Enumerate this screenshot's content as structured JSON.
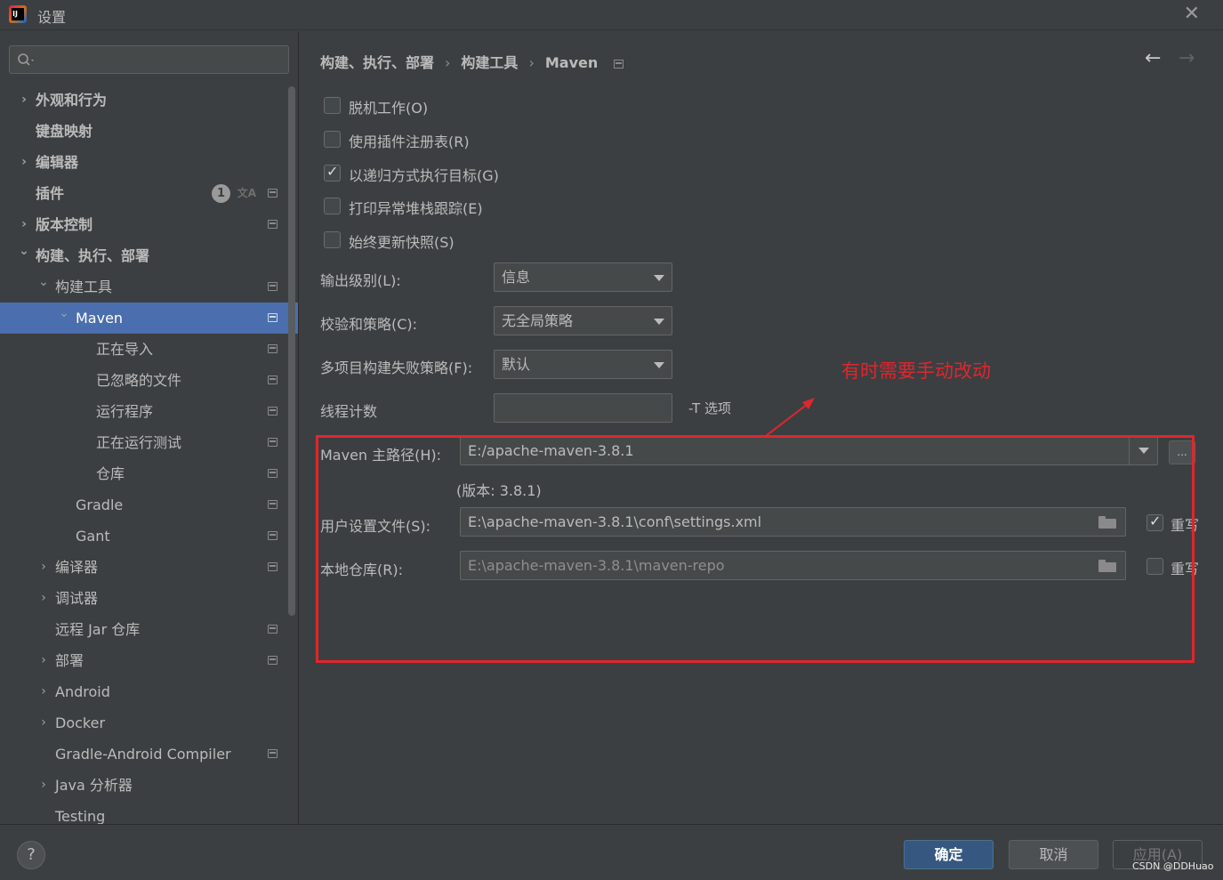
{
  "window": {
    "title": "设置"
  },
  "sidebar": {
    "search": {
      "placeholder": ""
    },
    "items": [
      {
        "label": "外观和行为",
        "arrow": "›",
        "indent": 0,
        "bold": true,
        "proj": false
      },
      {
        "label": "键盘映射",
        "arrow": "",
        "indent": 0,
        "bold": true,
        "proj": false
      },
      {
        "label": "编辑器",
        "arrow": "›",
        "indent": 0,
        "bold": true,
        "proj": false
      },
      {
        "label": "插件",
        "arrow": "",
        "indent": 0,
        "bold": true,
        "proj": true,
        "badge": "1",
        "extra_icon": "translate-icon"
      },
      {
        "label": "版本控制",
        "arrow": "›",
        "indent": 0,
        "bold": true,
        "proj": true
      },
      {
        "label": "构建、执行、部署",
        "arrow": "⌄",
        "indent": 0,
        "bold": true,
        "proj": false
      },
      {
        "label": "构建工具",
        "arrow": "⌄",
        "indent": 1,
        "bold": false,
        "proj": true
      },
      {
        "label": "Maven",
        "arrow": "⌄",
        "indent": 2,
        "bold": false,
        "proj": true,
        "selected": true
      },
      {
        "label": "正在导入",
        "arrow": "",
        "indent": 3,
        "bold": false,
        "proj": true
      },
      {
        "label": "已忽略的文件",
        "arrow": "",
        "indent": 3,
        "bold": false,
        "proj": true
      },
      {
        "label": "运行程序",
        "arrow": "",
        "indent": 3,
        "bold": false,
        "proj": true
      },
      {
        "label": "正在运行测试",
        "arrow": "",
        "indent": 3,
        "bold": false,
        "proj": true
      },
      {
        "label": "仓库",
        "arrow": "",
        "indent": 3,
        "bold": false,
        "proj": true
      },
      {
        "label": "Gradle",
        "arrow": "",
        "indent": 2,
        "bold": false,
        "proj": true
      },
      {
        "label": "Gant",
        "arrow": "",
        "indent": 2,
        "bold": false,
        "proj": true
      },
      {
        "label": "编译器",
        "arrow": "›",
        "indent": 1,
        "bold": false,
        "proj": true
      },
      {
        "label": "调试器",
        "arrow": "›",
        "indent": 1,
        "bold": false,
        "proj": false
      },
      {
        "label": "远程 Jar 仓库",
        "arrow": "",
        "indent": 1,
        "bold": false,
        "proj": true
      },
      {
        "label": "部署",
        "arrow": "›",
        "indent": 1,
        "bold": false,
        "proj": true
      },
      {
        "label": "Android",
        "arrow": "›",
        "indent": 1,
        "bold": false,
        "proj": false
      },
      {
        "label": "Docker",
        "arrow": "›",
        "indent": 1,
        "bold": false,
        "proj": false
      },
      {
        "label": "Gradle-Android Compiler",
        "arrow": "",
        "indent": 1,
        "bold": false,
        "proj": true
      },
      {
        "label": "Java 分析器",
        "arrow": "›",
        "indent": 1,
        "bold": false,
        "proj": false
      },
      {
        "label": "Testing",
        "arrow": "",
        "indent": 1,
        "bold": false,
        "proj": false
      }
    ]
  },
  "breadcrumb": {
    "parts": [
      "构建、执行、部署",
      "构建工具",
      "Maven"
    ]
  },
  "options": {
    "work_offline": {
      "label": "脱机工作(O)",
      "checked": false
    },
    "use_plugin_registry": {
      "label": "使用插件注册表(R)",
      "checked": false
    },
    "recursive": {
      "label": "以递归方式执行目标(G)",
      "checked": true
    },
    "print_stacktrace": {
      "label": "打印异常堆栈跟踪(E)",
      "checked": false
    },
    "always_update": {
      "label": "始终更新快照(S)",
      "checked": false
    }
  },
  "form": {
    "output_level": {
      "label": "输出级别(L):",
      "value": "信息"
    },
    "checksum_policy": {
      "label": "校验和策略(C):",
      "value": "无全局策略"
    },
    "multiproject_fail": {
      "label": "多项目构建失败策略(F):",
      "value": "默认"
    },
    "thread_count": {
      "label": "线程计数",
      "value": "",
      "hint": "-T 选项"
    },
    "maven_home": {
      "label": "Maven 主路径(H):",
      "value": "E:/apache-maven-3.8.1",
      "version": "(版本: 3.8.1)",
      "browse_label": "..."
    },
    "user_settings": {
      "label": "用户设置文件(S):",
      "value": "E:\\apache-maven-3.8.1\\conf\\settings.xml",
      "override_label": "重写",
      "override_checked": true
    },
    "local_repo": {
      "label": "本地仓库(R):",
      "value": "E:\\apache-maven-3.8.1\\maven-repo",
      "override_label": "重写",
      "override_checked": false
    }
  },
  "annotation": {
    "text": "有时需要手动改动",
    "color": "#e0262d"
  },
  "footer": {
    "help": "?",
    "ok": "确定",
    "cancel": "取消",
    "apply": "应用(A)",
    "watermark": "CSDN @DDHuao"
  },
  "colors": {
    "selection": "#4b6eaf",
    "background": "#3c3f41",
    "primary_button": "#365880"
  }
}
